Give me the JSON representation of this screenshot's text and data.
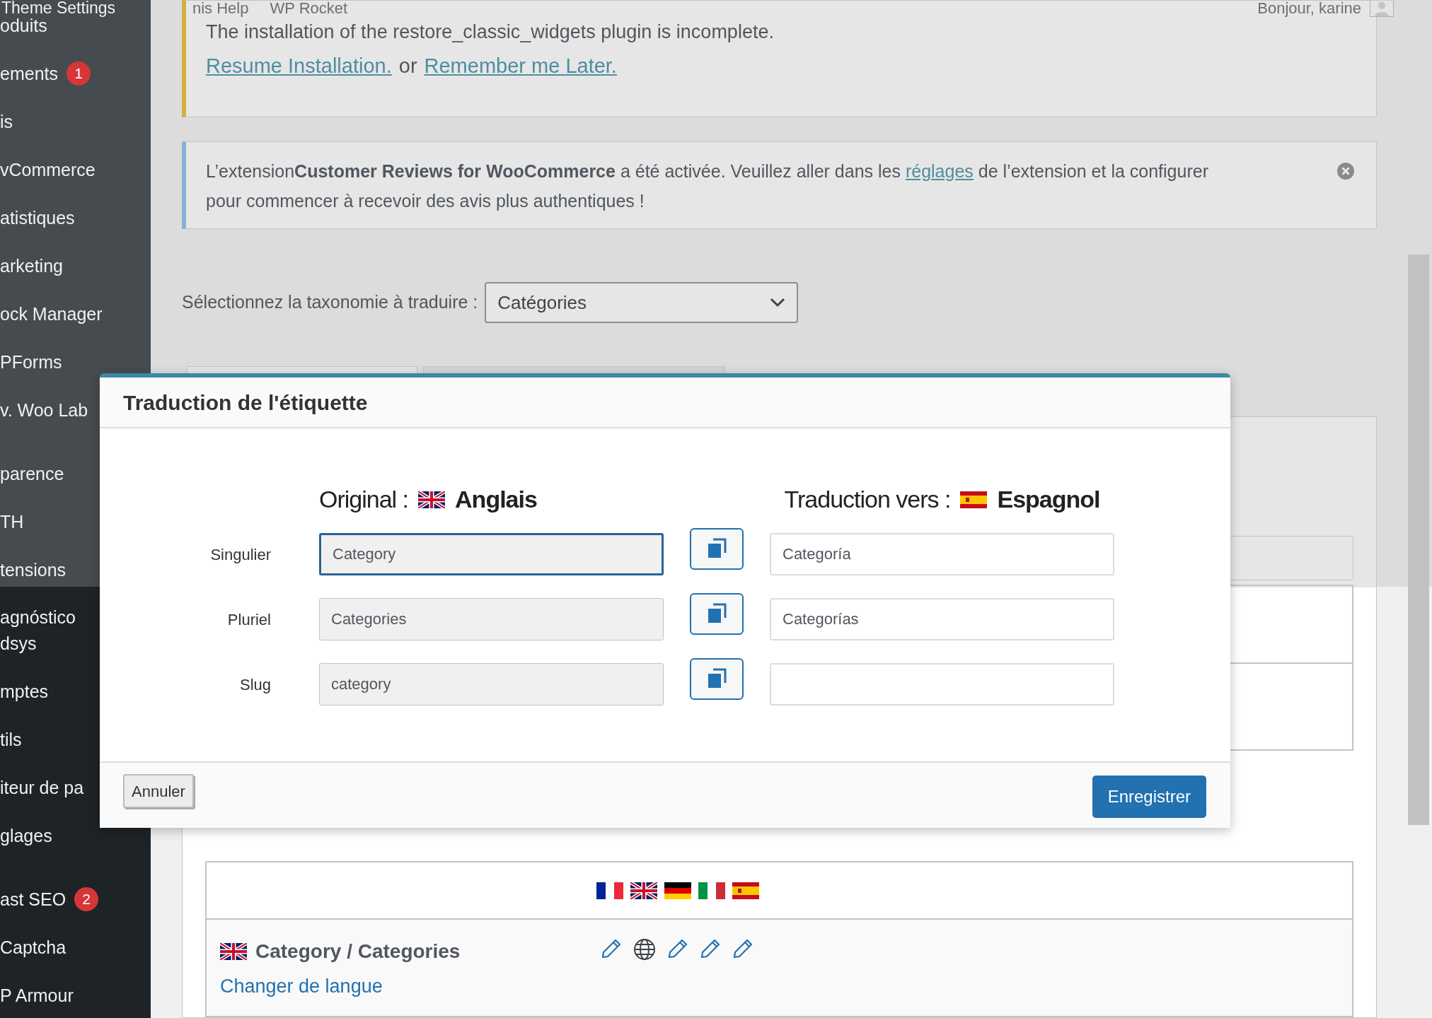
{
  "admin_bar": {
    "items": [
      "Theme Settings",
      "nis Help",
      "WP Rocket"
    ],
    "greeting": "Bonjour, karine"
  },
  "sidebar": {
    "groups": [
      {
        "items": [
          {
            "label": "oduits"
          },
          {
            "label": "ements",
            "badge": "1"
          },
          {
            "label": "is"
          },
          {
            "label": "vCommerce"
          },
          {
            "label": "atistiques"
          },
          {
            "label": "arketing"
          },
          {
            "label": "ock Manager"
          },
          {
            "label": "PForms"
          },
          {
            "label": "v. Woo Lab"
          }
        ]
      },
      {
        "items": [
          {
            "label": "parence"
          },
          {
            "label": "TH"
          },
          {
            "label": "tensions"
          },
          {
            "label": "agnóstico\ndsys"
          },
          {
            "label": "mptes"
          },
          {
            "label": "tils"
          },
          {
            "label": "iteur de pa"
          },
          {
            "label": "glages"
          }
        ]
      },
      {
        "items": [
          {
            "label": "ast SEO",
            "badge": "2"
          },
          {
            "label": "Captcha"
          },
          {
            "label": "P Armour"
          }
        ]
      }
    ]
  },
  "notices": [
    {
      "kind": "warning",
      "text": "The installation of the restore_classic_widgets plugin is incomplete.",
      "links": [
        "Resume Installation.",
        "Remember me Later."
      ],
      "joiner": "or"
    },
    {
      "kind": "info",
      "text_before": "L’extension**Customer Reviews for WooCommerce** a été activée. Veuillez aller dans les",
      "link": "réglages",
      "text_after": "de l’extension et la configurer pour commencer à recevoir des avis plus authentiques !"
    }
  ],
  "taxonomy_select": {
    "label": "Sélectionnez la taxonomie à traduire :",
    "value": "Catégories"
  },
  "modal": {
    "title": "Traduction de l'étiquette",
    "source_heading": {
      "label": "Original :",
      "language": "Anglais"
    },
    "target_heading": {
      "label": "Traduction vers :",
      "language": "Espagnol"
    },
    "rows": [
      {
        "label": "Singulier",
        "original": "Category",
        "translation": "Categoría",
        "focused": true
      },
      {
        "label": "Pluriel",
        "original": "Categories",
        "translation": "Categorías",
        "focused": false
      },
      {
        "label": "Slug",
        "original": "category",
        "focused": false
      }
    ],
    "cancel": "Annuler",
    "save": "Enregistrer"
  },
  "terms_table": {
    "rows": [
      {
        "title": "Category / Categories",
        "link": "Changer de langue"
      }
    ]
  }
}
